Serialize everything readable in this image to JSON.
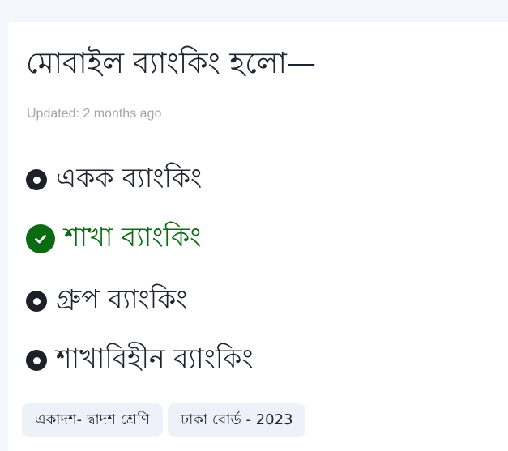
{
  "question": {
    "text": "মোবাইল ব্যাংকিং হলো—",
    "updated": "Updated: 2 months ago"
  },
  "options": [
    {
      "label": "একক ব্যাংকিং",
      "correct": false,
      "icon": "bullet-icon"
    },
    {
      "label": "শাখা ব্যাংকিং",
      "correct": true,
      "icon": "check-circle-icon"
    },
    {
      "label": "গ্রুপ ব্যাংকিং",
      "correct": false,
      "icon": "bullet-icon"
    },
    {
      "label": "শাখাবিহীন ব্যাংকিং",
      "correct": false,
      "icon": "bullet-icon"
    }
  ],
  "tags": [
    {
      "label": "একাদশ- দ্বাদশ শ্রেণি"
    },
    {
      "label": "ঢাকা বোর্ড - 2023"
    }
  ],
  "colors": {
    "correct": "#0c6b12",
    "text": "#1d2530",
    "muted": "#a0a5ad",
    "tag_bg": "#eef2f8"
  }
}
